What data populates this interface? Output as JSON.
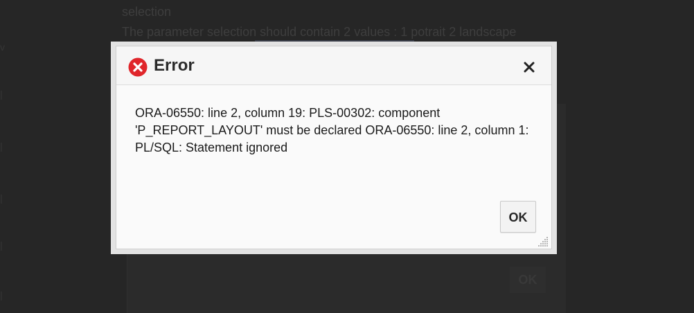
{
  "background": {
    "text_line1": "selection",
    "text_line2": "The parameter selection should contain 2 values : 1 potrait 2 landscape",
    "ok_label": "OK"
  },
  "dialog": {
    "title": "Error",
    "icon": "error-circle-icon",
    "close_icon": "close-icon",
    "message": "ORA-06550: line 2, column 19: PLS-00302: component 'P_REPORT_LAYOUT' must be declared ORA-06550: line 2, column 1: PL/SQL: Statement ignored",
    "ok_label": "OK",
    "colors": {
      "error_red": "#e0262b",
      "overlay": "#262626",
      "dialog_bg": "#fafafa"
    }
  }
}
